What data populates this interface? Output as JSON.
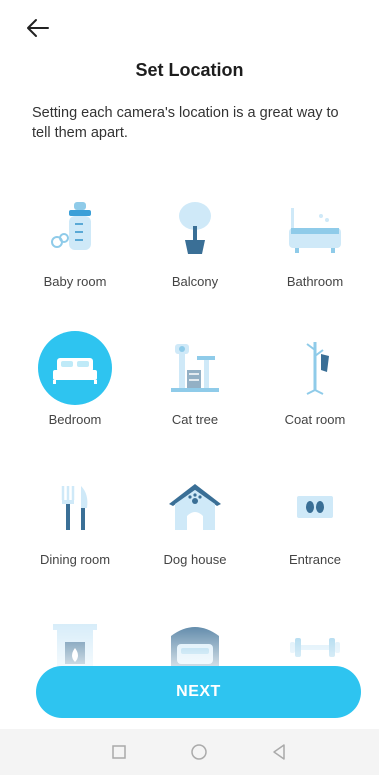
{
  "header": {
    "title": "Set Location",
    "back_icon": "arrow-left-icon"
  },
  "description": "Setting each camera's location is a great way to tell them apart.",
  "locations": [
    {
      "label": "Baby room",
      "icon": "baby-bottle-icon",
      "selected": false
    },
    {
      "label": "Balcony",
      "icon": "potted-tree-icon",
      "selected": false
    },
    {
      "label": "Bathroom",
      "icon": "bathtub-icon",
      "selected": false
    },
    {
      "label": "Bedroom",
      "icon": "bed-icon",
      "selected": true
    },
    {
      "label": "Cat tree",
      "icon": "cat-tree-icon",
      "selected": false
    },
    {
      "label": "Coat room",
      "icon": "coat-rack-icon",
      "selected": false
    },
    {
      "label": "Dining room",
      "icon": "fork-knife-icon",
      "selected": false
    },
    {
      "label": "Dog house",
      "icon": "dog-house-icon",
      "selected": false
    },
    {
      "label": "Entrance",
      "icon": "footprints-mat-icon",
      "selected": false
    },
    {
      "label": "",
      "icon": "fireplace-icon",
      "selected": false
    },
    {
      "label": "",
      "icon": "garage-car-icon",
      "selected": false
    },
    {
      "label": "",
      "icon": "dumbbell-icon",
      "selected": false
    }
  ],
  "next_button": {
    "label": "NEXT"
  },
  "colors": {
    "accent": "#2ec4f0",
    "icon_light": "#cfe9f8",
    "icon_mid": "#8fcbe9",
    "icon_dark": "#3a6f96"
  },
  "nav_bar": {
    "recent_icon": "square-icon",
    "home_icon": "circle-icon",
    "back_icon": "triangle-back-icon"
  }
}
